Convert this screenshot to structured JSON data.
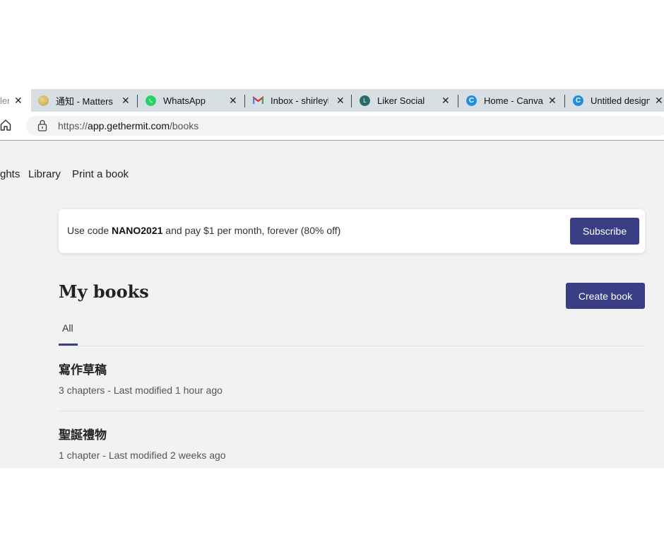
{
  "tabs": [
    {
      "label": "ler",
      "icon": "partial-tab",
      "active": true
    },
    {
      "label": "通知 - Matters",
      "icon": "matters-icon"
    },
    {
      "label": "WhatsApp",
      "icon": "whatsapp-icon",
      "color": "#25d366"
    },
    {
      "label": "Inbox - shirleyl",
      "icon": "gmail-icon"
    },
    {
      "label": "Liker Social",
      "icon": "liker-icon",
      "color": "#2b6a6c"
    },
    {
      "label": "Home - Canva",
      "icon": "canva-icon",
      "color": "#1d8fe0"
    },
    {
      "label": "Untitled design",
      "icon": "canva-icon",
      "color": "#1d8fe0"
    }
  ],
  "tab_close": "✕",
  "address": {
    "prefix": "https://",
    "domain": "app.gethermit.com",
    "path": "/books"
  },
  "nav": {
    "insights": "ghts",
    "library": "Library",
    "print": "Print a book"
  },
  "banner": {
    "text_before": "Use code ",
    "code": "NANO2021",
    "text_after": " and pay $1 per month, forever (80% off)",
    "button": "Subscribe"
  },
  "books_section": {
    "title": "My books",
    "create_button": "Create book",
    "filter_tab": "All"
  },
  "books": [
    {
      "title": "寫作草稿",
      "meta": "3 chapters - Last modified 1 hour ago"
    },
    {
      "title": "聖誕禮物",
      "meta": "1 chapter - Last modified 2 weeks ago"
    }
  ],
  "colors": {
    "accent": "#3a3f85",
    "tabbar": "#d7dfe3"
  }
}
